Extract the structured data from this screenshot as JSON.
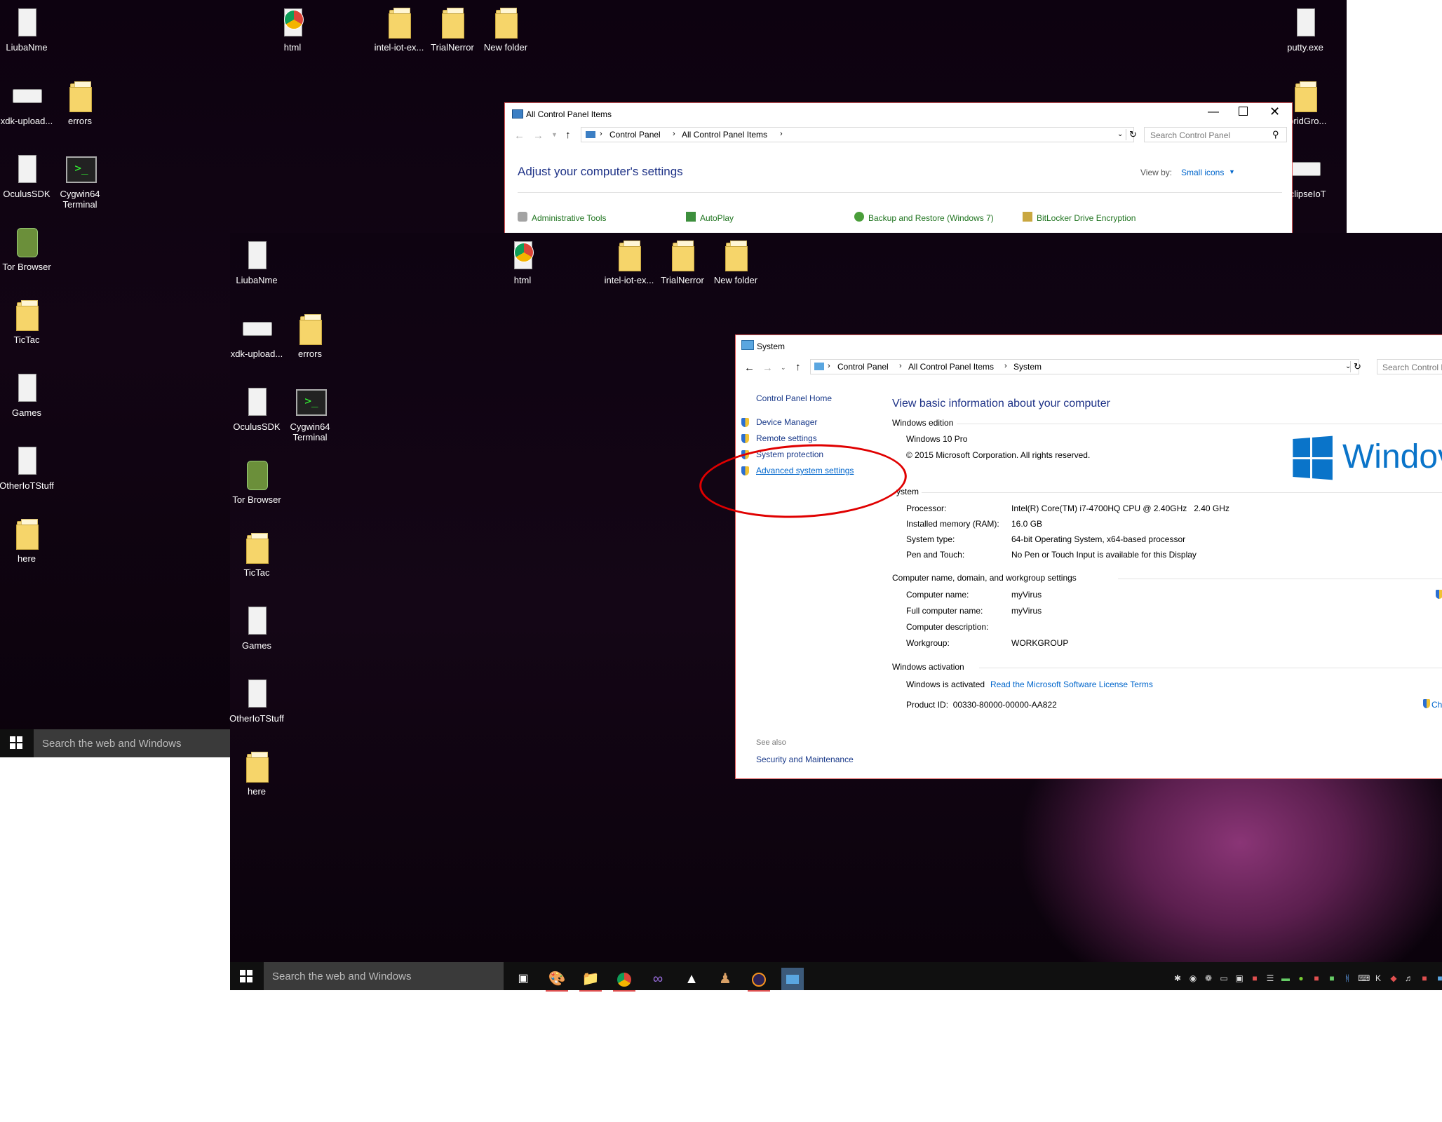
{
  "desktop_back": {
    "icons": [
      {
        "label": "LiubaNme",
        "kind": "doc"
      },
      {
        "label": "html",
        "kind": "chrome"
      },
      {
        "label": "intel-iot-ex...",
        "kind": "folder"
      },
      {
        "label": "TrialNerror",
        "kind": "folder"
      },
      {
        "label": "New folder",
        "kind": "folder"
      },
      {
        "label": "putty.exe",
        "kind": "doc"
      },
      {
        "label": "xdk-upload...",
        "kind": "usb"
      },
      {
        "label": "errors",
        "kind": "folder"
      },
      {
        "label": "ybridGro...",
        "kind": "folder"
      },
      {
        "label": "OculusSDK",
        "kind": "doc"
      },
      {
        "label": "Cygwin64 Terminal",
        "kind": "term"
      },
      {
        "label": "eclipseIoT",
        "kind": "usb"
      },
      {
        "label": "Tor Browser",
        "kind": "tor"
      },
      {
        "label": "TicTac",
        "kind": "folder"
      },
      {
        "label": "Games",
        "kind": "doc"
      },
      {
        "label": "OtherIoTStuff",
        "kind": "doc"
      },
      {
        "label": "here",
        "kind": "folder"
      }
    ],
    "taskbar_search": "Search the web and Windows"
  },
  "control_panel_window": {
    "title": "All Control Panel Items",
    "breadcrumb": [
      "Control Panel",
      "All Control Panel Items"
    ],
    "search_placeholder": "Search Control Panel",
    "heading": "Adjust your computer's settings",
    "view_by_label": "View by:",
    "view_by_value": "Small icons",
    "items": [
      "Administrative Tools",
      "AutoPlay",
      "Backup and Restore (Windows 7)",
      "BitLocker Drive Encryption"
    ]
  },
  "desktop_front": {
    "icons": [
      {
        "label": "LiubaNme",
        "kind": "doc"
      },
      {
        "label": "html",
        "kind": "chrome"
      },
      {
        "label": "intel-iot-ex...",
        "kind": "folder"
      },
      {
        "label": "TrialNerror",
        "kind": "folder"
      },
      {
        "label": "New folder",
        "kind": "folder"
      },
      {
        "label": "xdk-upload...",
        "kind": "usb"
      },
      {
        "label": "errors",
        "kind": "folder"
      },
      {
        "label": "OculusSDK",
        "kind": "doc"
      },
      {
        "label": "Cygwin64 Terminal",
        "kind": "term"
      },
      {
        "label": "Tor Browser",
        "kind": "tor"
      },
      {
        "label": "TicTac",
        "kind": "folder"
      },
      {
        "label": "Games",
        "kind": "doc"
      },
      {
        "label": "OtherIoTStuff",
        "kind": "doc"
      },
      {
        "label": "here",
        "kind": "folder"
      }
    ],
    "taskbar_search": "Search the web and Windows"
  },
  "system_window": {
    "title": "System",
    "breadcrumb": [
      "Control Panel",
      "All Control Panel Items",
      "System"
    ],
    "search_placeholder": "Search Control P",
    "left_nav": {
      "home": "Control Panel Home",
      "links": [
        "Device Manager",
        "Remote settings",
        "System protection",
        "Advanced system settings"
      ],
      "see_also_label": "See also",
      "see_also": [
        "Security and Maintenance"
      ]
    },
    "heading": "View basic information about your computer",
    "windows_edition": {
      "section": "Windows edition",
      "edition": "Windows 10 Pro",
      "copyright": "© 2015 Microsoft Corporation. All rights reserved."
    },
    "logo_text": "Windov",
    "system": {
      "section": "ystem",
      "rows": [
        {
          "label": "Processor:",
          "value": "Intel(R) Core(TM) i7-4700HQ CPU @ 2.40GHz   2.40 GHz"
        },
        {
          "label": "Installed memory (RAM):",
          "value": "16.0 GB"
        },
        {
          "label": "System type:",
          "value": "64-bit Operating System, x64-based processor"
        },
        {
          "label": "Pen and Touch:",
          "value": "No Pen or Touch Input is available for this Display"
        }
      ]
    },
    "computer_name": {
      "section": "Computer name, domain, and workgroup settings",
      "rows": [
        {
          "label": "Computer name:",
          "value": "myVirus"
        },
        {
          "label": "Full computer name:",
          "value": "myVirus"
        },
        {
          "label": "Computer description:",
          "value": ""
        },
        {
          "label": "Workgroup:",
          "value": "WORKGROUP"
        }
      ]
    },
    "activation": {
      "section": "Windows activation",
      "status": "Windows is activated",
      "license_link": "Read the Microsoft Software License Terms",
      "product_id": "Product ID:  00330-80000-00000-AA822",
      "change_key_partial": "Ch"
    }
  },
  "colors": {
    "accent": "#0066cc",
    "heading": "#1e3287",
    "highlight_ellipse": "#e00000"
  }
}
